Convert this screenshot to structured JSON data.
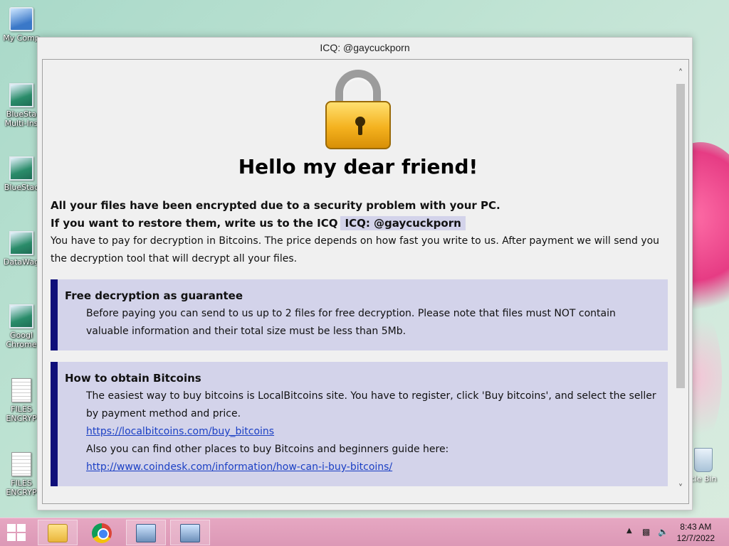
{
  "desktop": {
    "icons": [
      {
        "label": "My Comp"
      },
      {
        "label": "BlueSta"
      },
      {
        "label": "Multi-Ins"
      },
      {
        "label": "BlueStac"
      },
      {
        "label": "DataWag"
      },
      {
        "label": "Googl"
      },
      {
        "label": "Chrome"
      },
      {
        "label": "FILES"
      },
      {
        "label": "ENCRYP"
      },
      {
        "label": "FILES"
      },
      {
        "label": "ENCRYP"
      }
    ],
    "recycle_label": "cle Bin"
  },
  "window": {
    "title": "ICQ: @gaycuckporn",
    "heading": "Hello my dear friend!",
    "line1": "All your files have been encrypted due to a security problem with your PC.",
    "line2": "If you want to restore them, write us to the ICQ",
    "icq_tag": "ICQ: @gaycuckporn",
    "line3": "You have to pay for decryption in Bitcoins. The price depends on how fast you write to us. After payment we will send you the decryption tool that will decrypt all your files.",
    "block1": {
      "title": "Free decryption as guarantee",
      "text": "Before paying you can send to us up to 2 files for free decryption. Please note that files must NOT contain valuable information and their total size must be less than 5Mb."
    },
    "block2": {
      "title": "How to obtain Bitcoins",
      "text": "The easiest way to buy bitcoins is LocalBitcoins site. You have to register, click 'Buy bitcoins', and select the seller by payment method and price.",
      "link1": "https://localbitcoins.com/buy_bitcoins",
      "text2": "Also you can find other places to buy Bitcoins and beginners guide here:",
      "link2": "http://www.coindesk.com/information/how-can-i-buy-bitcoins/"
    }
  },
  "taskbar": {
    "time": "8:43 AM",
    "date": "12/7/2022"
  }
}
